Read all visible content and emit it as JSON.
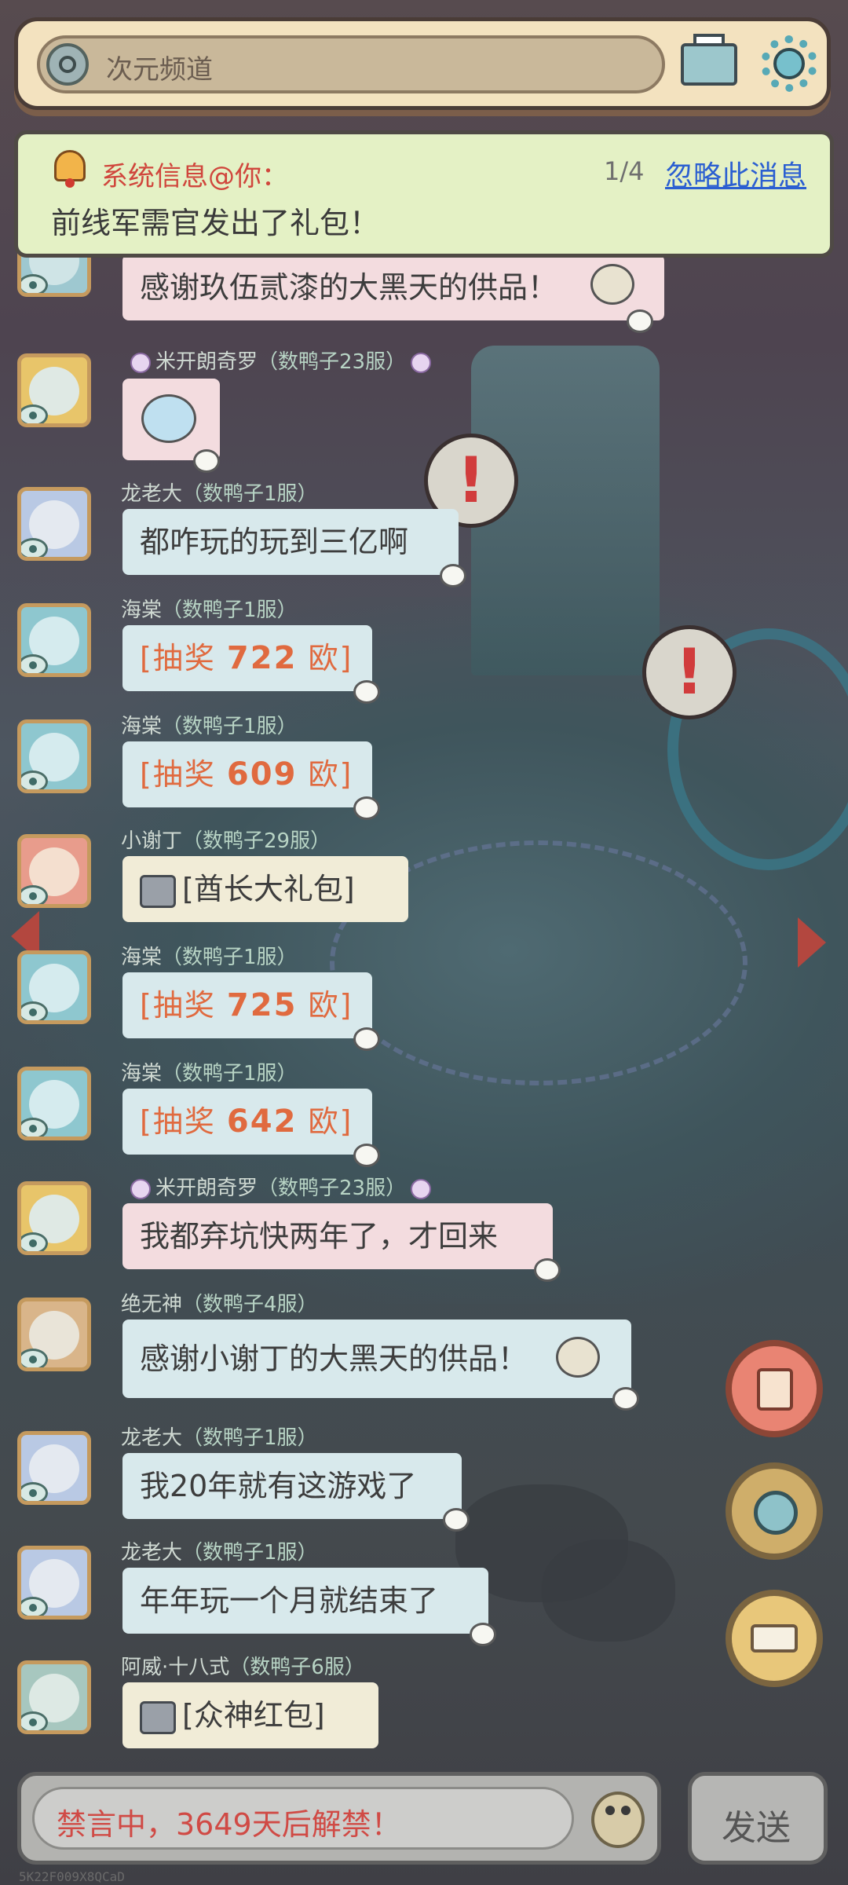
{
  "header": {
    "channel_label": "次元频道"
  },
  "notice": {
    "title": "系统信息@你：",
    "counter": "1/4",
    "ignore_label": "忽略此消息",
    "body": "前线军需官发出了礼包！"
  },
  "messages": [
    {
      "name": "",
      "server": "",
      "text": "感谢玖伍贰漆的大黑天的供品！"
    },
    {
      "name": "米开朗奇罗",
      "server": "（数鸭子23服）",
      "text": ""
    },
    {
      "name": "龙老大",
      "server": "（数鸭子1服）",
      "text": "都咋玩的玩到三亿啊"
    },
    {
      "name": "海棠",
      "server": "（数鸭子1服）",
      "prefix": "[抽奖 ",
      "num": "722",
      "suffix": " 欧]"
    },
    {
      "name": "海棠",
      "server": "（数鸭子1服）",
      "prefix": "[抽奖 ",
      "num": "609",
      "suffix": " 欧]"
    },
    {
      "name": "小谢丁",
      "server": "（数鸭子29服）",
      "text": "[酋长大礼包]"
    },
    {
      "name": "海棠",
      "server": "（数鸭子1服）",
      "prefix": "[抽奖 ",
      "num": "725",
      "suffix": " 欧]"
    },
    {
      "name": "海棠",
      "server": "（数鸭子1服）",
      "prefix": "[抽奖 ",
      "num": "642",
      "suffix": " 欧]"
    },
    {
      "name": "米开朗奇罗",
      "server": "（数鸭子23服）",
      "text": "我都弃坑快两年了，才回来"
    },
    {
      "name": "绝无神",
      "server": "（数鸭子4服）",
      "text": "感谢小谢丁的大黑天的供品！"
    },
    {
      "name": "龙老大",
      "server": "（数鸭子1服）",
      "text": "我20年就有这游戏了"
    },
    {
      "name": "龙老大",
      "server": "（数鸭子1服）",
      "text": "年年玩一个月就结束了"
    },
    {
      "name": "阿威·十八式",
      "server": "（数鸭子6服）",
      "text": "[众神红包]"
    }
  ],
  "input": {
    "mute_text": "禁言中，3649天后解禁！",
    "send_label": "发送"
  },
  "watermark": "5K22F009X8QCaD",
  "icons": [
    "channel-icon",
    "mail-icon",
    "gear-icon",
    "bell-icon",
    "eye-icon",
    "gift-icon",
    "redpacket-icon",
    "arrow-right-icon",
    "emoji-icon",
    "alert-icon"
  ],
  "colors": {
    "accent_red": "#d0463c",
    "lottery_orange": "#e06a3f",
    "link_blue": "#2b5fd1",
    "bubble_blue": "#d8e9ec",
    "bubble_pink": "#f3dcdf",
    "notice_bg": "#e4f1c5"
  }
}
